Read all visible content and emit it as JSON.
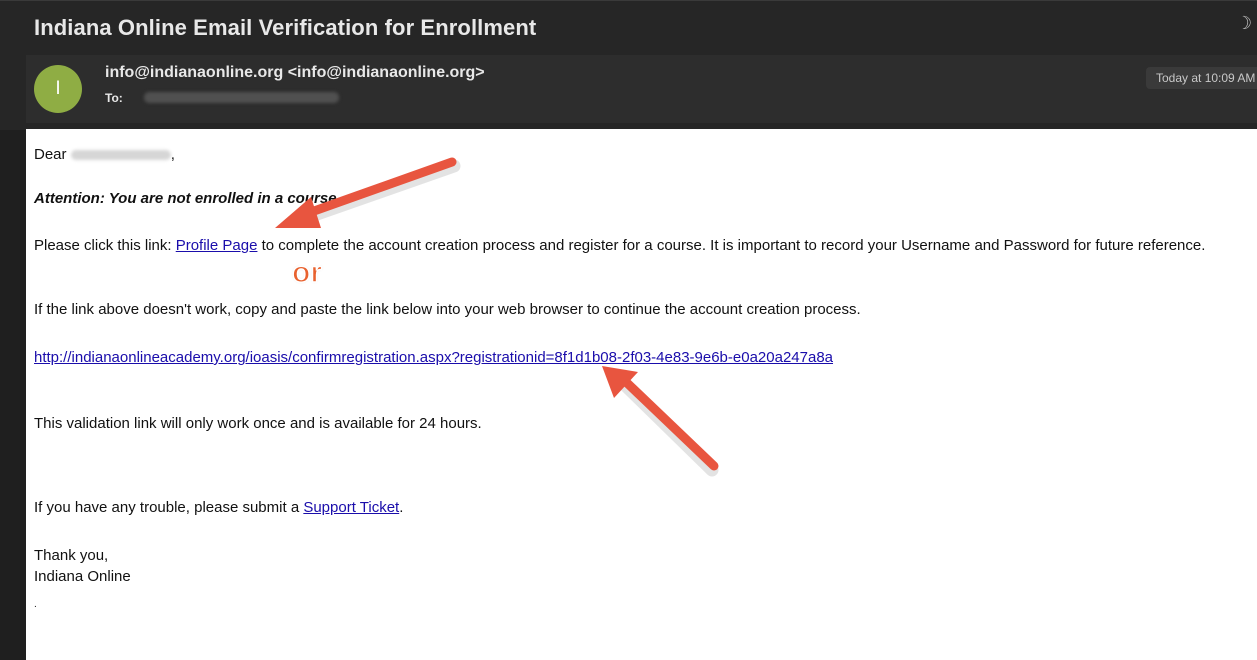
{
  "email": {
    "subject": "Indiana Online Email Verification for Enrollment",
    "avatar_initial": "I",
    "from": "info@indianaonline.org <info@indianaonline.org>",
    "to_label": "To:",
    "date": "Today at 10:09 AM",
    "body": {
      "greeting_prefix": "Dear",
      "greeting_suffix": ",",
      "attention": "Attention: You are not enrolled in a course.",
      "p1_prefix": "Please click this link: ",
      "p1_link": "Profile Page",
      "p1_suffix": " to complete the account creation process and register for a course. It is important to record your Username and Password for future reference.",
      "p2": "If the link above doesn't work, copy and paste the link below into your web browser to continue the account creation process.",
      "long_link": "http://indianaonlineacademy.org/ioasis/confirmregistration.aspx?registrationid=8f1d1b08-2f03-4e83-9e6b-e0a20a247a8a",
      "validity": "This validation link will only work once and is available for 24 hours.",
      "trouble_prefix": "If you have any trouble, please submit a ",
      "trouble_link": "Support Ticket",
      "trouble_suffix": ".",
      "thanks": "Thank you,",
      "signature": "Indiana Online",
      "trailing_dot": "."
    }
  },
  "annotations": {
    "or_text": "or",
    "arrow_color": "#e8553f"
  },
  "colors": {
    "header_bg": "#262626",
    "meta_bg": "#2d2d2d",
    "avatar_bg": "#8fad44",
    "link": "#1a0dab"
  }
}
